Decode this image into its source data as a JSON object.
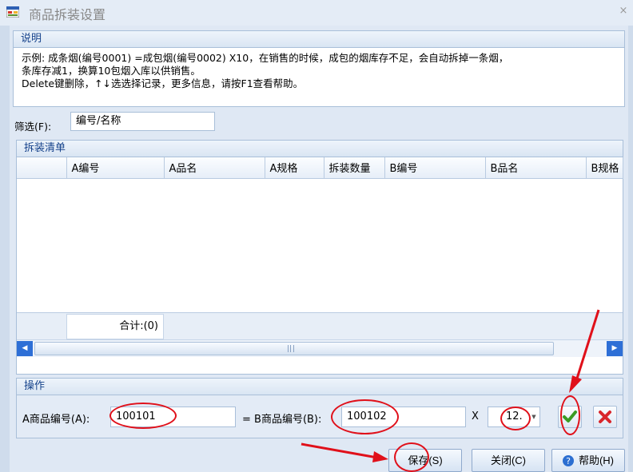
{
  "window": {
    "title": "商品拆装设置",
    "close_glyph": "×"
  },
  "description": {
    "header": "说明",
    "text": "示例: 成条烟(编号0001) =成包烟(编号0002) X10，在销售的时候，成包的烟库存不足，会自动拆掉一条烟，\n条库存减1，换算10包烟入库以供销售。\nDelete键删除，↑↓选选择记录，更多信息，请按F1查看帮助。"
  },
  "filter": {
    "label": "筛选(F):",
    "value": "编号/名称"
  },
  "list": {
    "header": "拆装清单",
    "columns": [
      "A编号",
      "A品名",
      "A规格",
      "拆装数量",
      "B编号",
      "B品名",
      "B规格"
    ],
    "rows": [],
    "summary": "合计:(0)"
  },
  "operation": {
    "header": "操作",
    "a_label": "A商品编号(A):",
    "a_value": "100101",
    "eq_label": "= B商品编号(B):",
    "b_value": "100102",
    "x_label": "X",
    "qty_value": "12."
  },
  "buttons": {
    "save": "保存(S)",
    "close": "关闭(C)",
    "help": "帮助(H)"
  },
  "colors": {
    "annotation": "#e0101a",
    "accent": "#15428b",
    "scroll": "#2e6fd6"
  }
}
